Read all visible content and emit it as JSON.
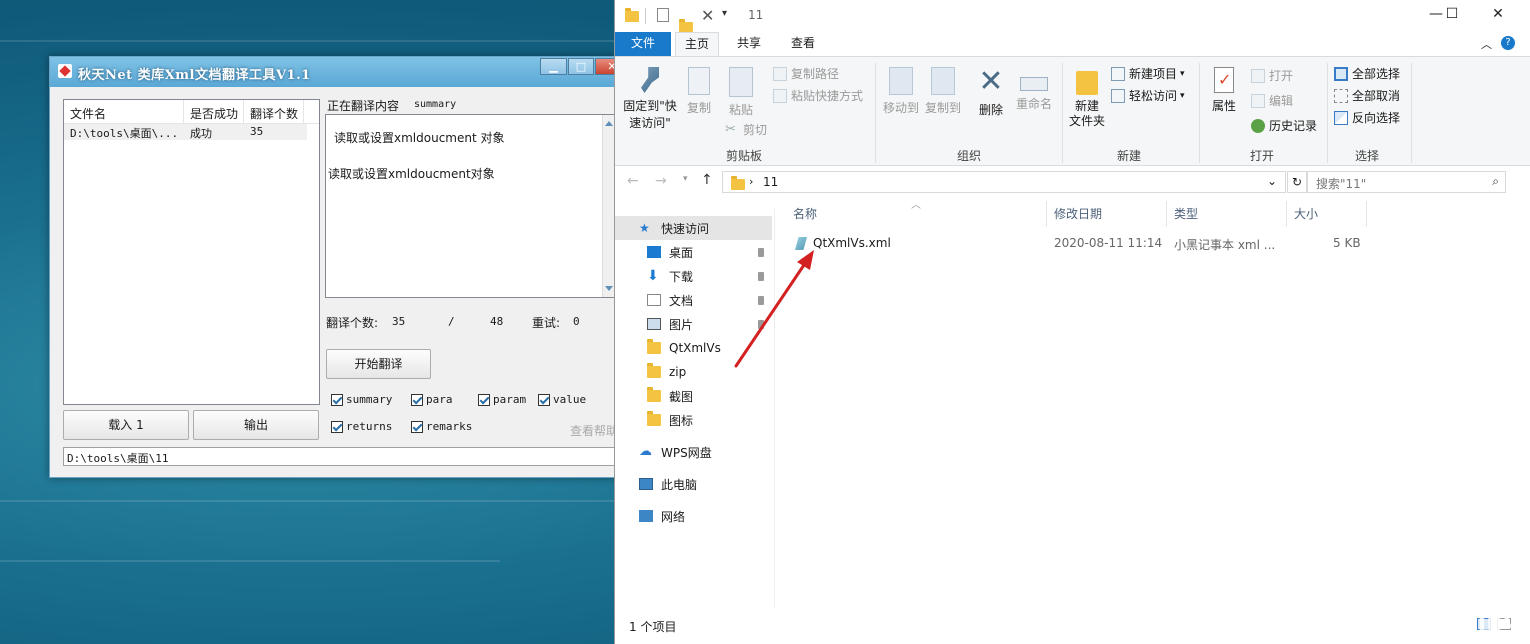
{
  "tool": {
    "title": "秋天Net 类库Xml文档翻译工具V1.1",
    "table": {
      "headers": [
        "文件名",
        "是否成功",
        "翻译个数"
      ],
      "rows": [
        [
          "D:\\tools\\桌面\\...",
          "成功",
          "35"
        ]
      ]
    },
    "translating_label": "正在翻译内容",
    "translating_tag": "summary",
    "content_lines": [
      "读取或设置xmldoucment 对象",
      "读取或设置xmldoucment对象"
    ],
    "count_label": "翻译个数:",
    "count_done": "35",
    "count_sep": "/",
    "count_total": "48",
    "retry_label": "重试:",
    "retry_value": "0",
    "start_button": "开始翻译",
    "load_button": "载入 1",
    "output_button": "输出",
    "checkboxes": [
      "summary",
      "para",
      "param",
      "value",
      "returns",
      "remarks"
    ],
    "help_link": "查看帮助",
    "status_path": "D:\\tools\\桌面\\11"
  },
  "explorer": {
    "title_path": "11",
    "tabs": [
      "文件",
      "主页",
      "共享",
      "查看"
    ],
    "ribbon": {
      "pin": "固定到\"快\n速访问\"",
      "copy": "复制",
      "paste": "粘贴",
      "copy_path": "复制路径",
      "paste_shortcut": "粘贴快捷方式",
      "cut": "剪切",
      "clipboard": "剪贴板",
      "move_to": "移动到",
      "copy_to": "复制到",
      "delete": "删除",
      "rename": "重命名",
      "organize": "组织",
      "new_folder": "新建\n文件夹",
      "new_item": "新建项目",
      "easy_access": "轻松访问",
      "new": "新建",
      "properties": "属性",
      "open": "打开",
      "edit": "编辑",
      "history": "历史记录",
      "open_group": "打开",
      "select_all": "全部选择",
      "select_none": "全部取消",
      "invert": "反向选择",
      "select_group": "选择"
    },
    "address": "11",
    "search_placeholder": "搜索\"11\"",
    "nav": [
      "快速访问",
      "桌面",
      "下载",
      "文档",
      "图片",
      "QtXmlVs",
      "zip",
      "截图",
      "图标",
      "WPS网盘",
      "此电脑",
      "网络"
    ],
    "columns": [
      "名称",
      "修改日期",
      "类型",
      "大小"
    ],
    "files": [
      {
        "name": "QtXmlVs.xml",
        "date": "2020-08-11 11:14",
        "type": "小黑记事本 xml ...",
        "size": "5 KB"
      }
    ],
    "status": "1 个项目"
  },
  "colors": {
    "accent": "#1979ca",
    "arrow": "#d32020"
  }
}
